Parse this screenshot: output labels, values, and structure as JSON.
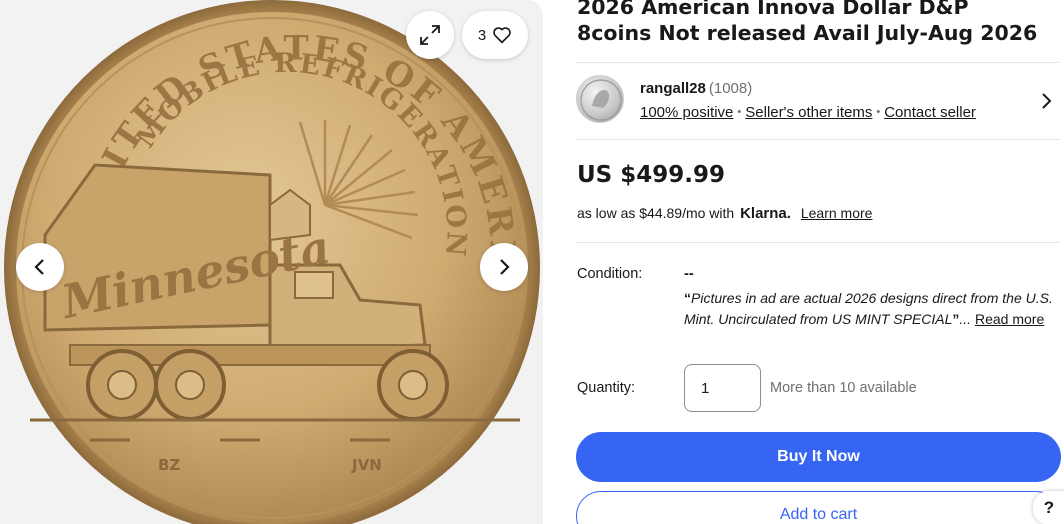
{
  "gallery": {
    "watch_count": "3",
    "coin": {
      "arc_top": "UNITED STATES OF AMERICA",
      "arc_inner": "MOBILE REFRIGERATION",
      "truck_text": "Minnesota",
      "initials_left": "BZ",
      "initials_right": "JVN",
      "colors": {
        "coin_base": "#c9a46c",
        "coin_light": "#e2c48f",
        "coin_dark": "#8a6a3c"
      }
    },
    "icons": {
      "expand": "expand-icon",
      "heart": "heart-icon",
      "prev": "chevron-left-icon",
      "next": "chevron-right-icon"
    }
  },
  "listing": {
    "title": "2026 American Innova Dollar D&P 8coins Not released Avail July-Aug 2026"
  },
  "seller": {
    "name": "rangall28",
    "feedback": "(1008)",
    "positive": "100% positive",
    "other_items": "Seller's other items",
    "contact": "Contact seller"
  },
  "price": {
    "amount": "US $499.99",
    "klarna_prefix": "as low as $44.89/mo with",
    "klarna_brand": "Klarna.",
    "learn_more": "Learn more"
  },
  "condition": {
    "label": "Condition:",
    "value": "--",
    "quote_open": "“",
    "description": "Pictures in ad are actual 2026 designs direct from the U.S. Mint. Uncirculated from US MINT SPECIAL",
    "quote_close": "”",
    "ellipsis": "...",
    "read_more": "Read more"
  },
  "quantity": {
    "label": "Quantity:",
    "value": "1",
    "available": "More than 10 available"
  },
  "actions": {
    "buy_now": "Buy It Now",
    "add_to_cart": "Add to cart",
    "help": "?"
  },
  "colors": {
    "primary": "#3665f3",
    "text": "#191919",
    "muted": "#707070",
    "gallery_bg": "#f2f2f2"
  }
}
